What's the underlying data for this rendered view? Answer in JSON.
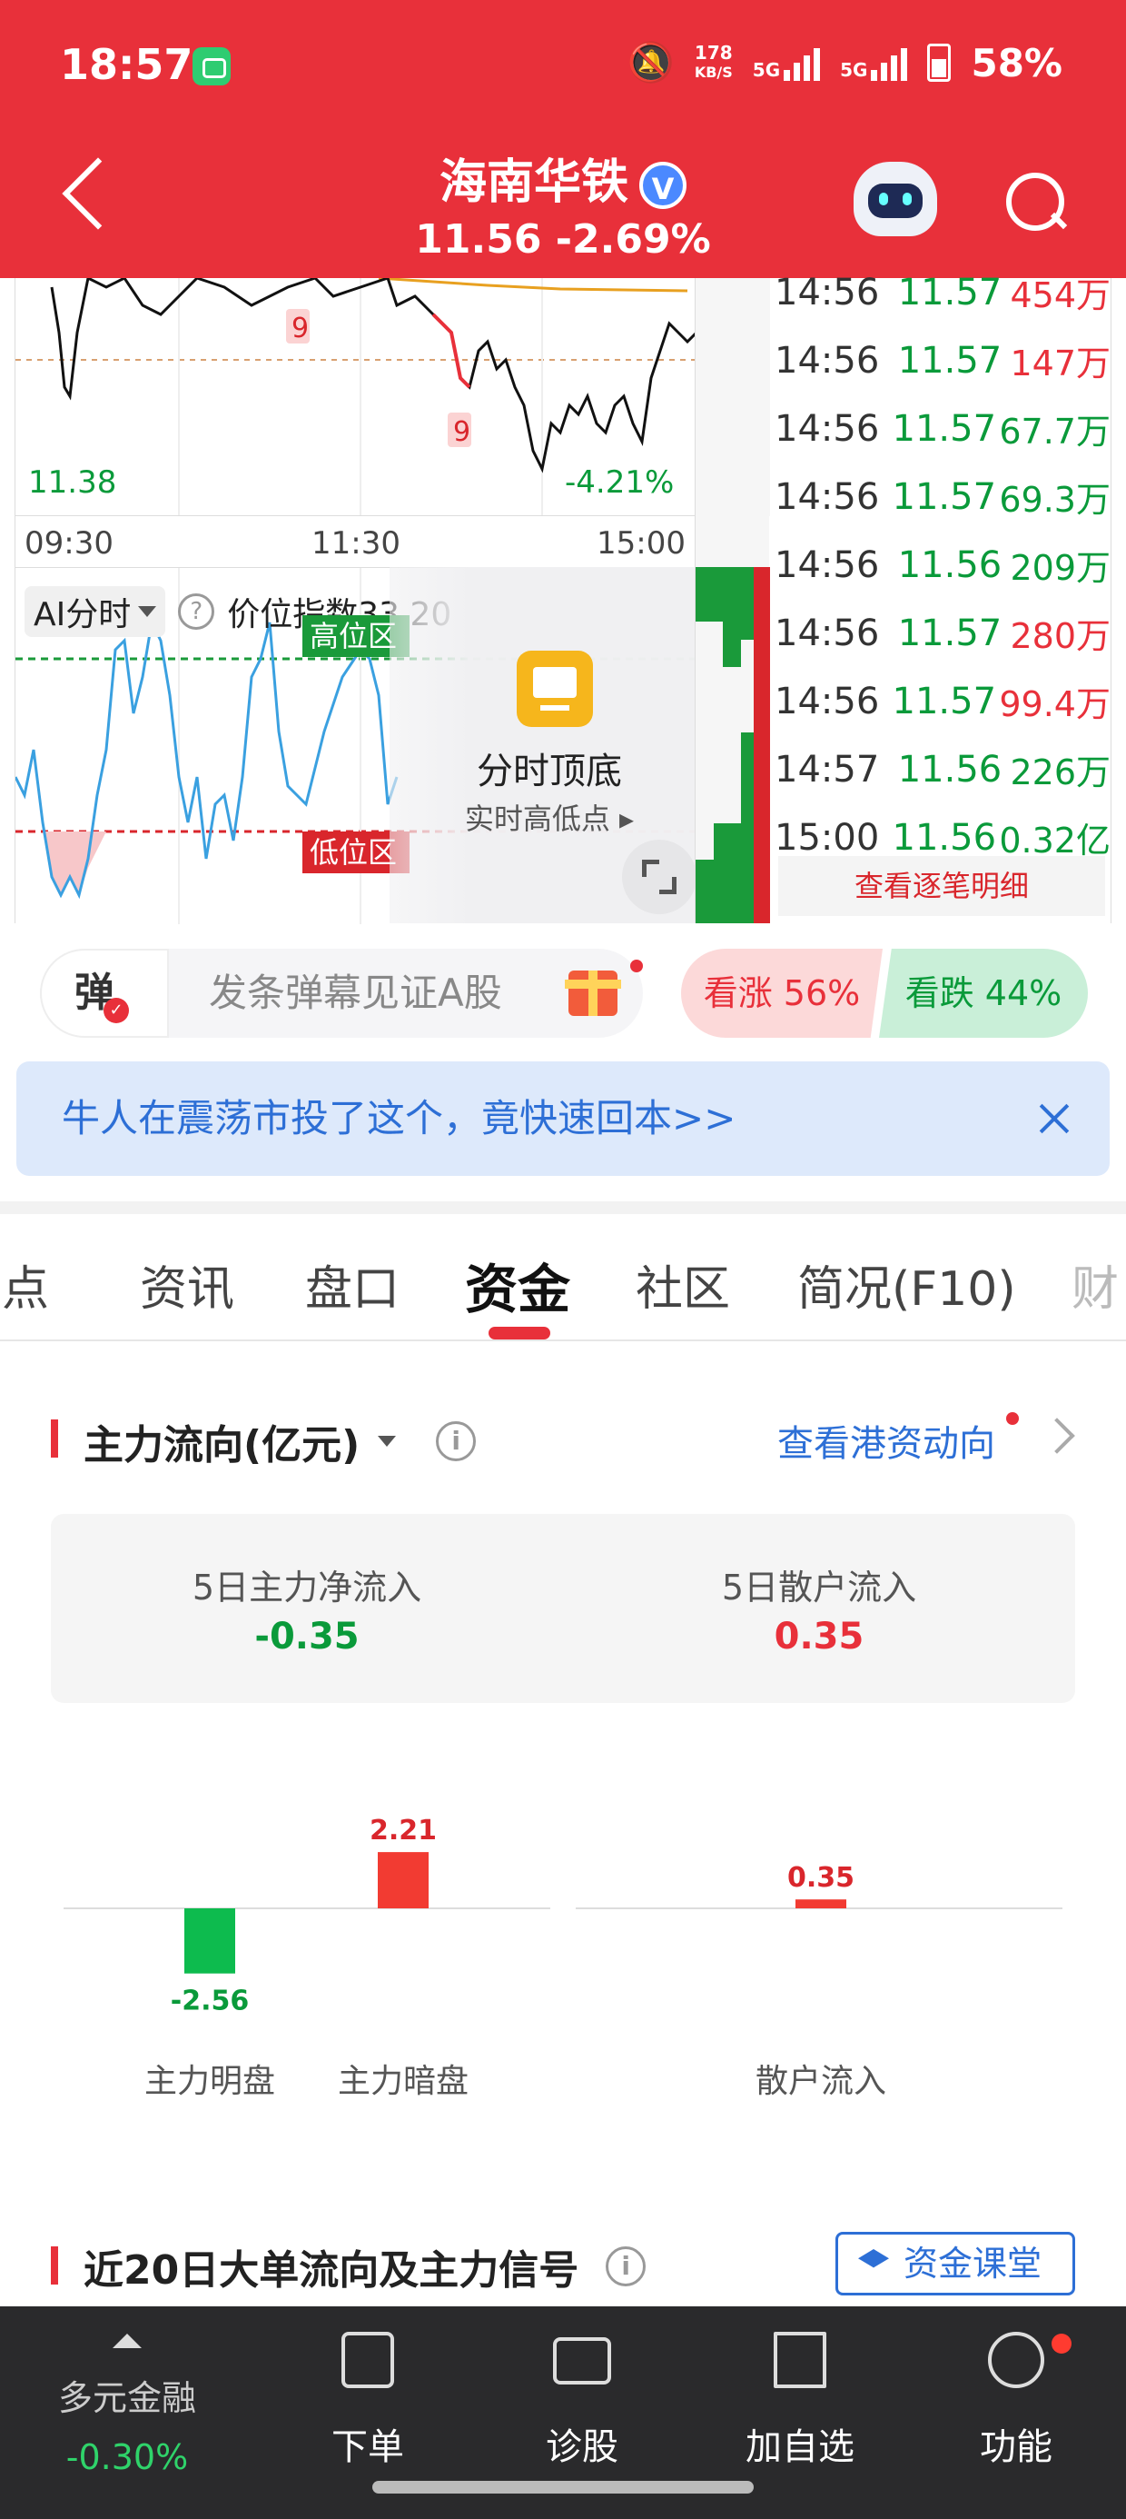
{
  "status": {
    "time": "18:57",
    "speed_value": "178",
    "speed_unit": "KB/S",
    "net1": "5G",
    "net2": "5G",
    "battery": "58%"
  },
  "header": {
    "stock_name": "海南华铁",
    "verified_mark": "V",
    "price": "11.56",
    "change": "-2.69%"
  },
  "intraday": {
    "low_price": "11.38",
    "low_pct": "-4.21%",
    "marker": "9",
    "times": [
      "09:30",
      "11:30",
      "15:00"
    ]
  },
  "ai_panel": {
    "mode_label": "AI分时",
    "help": "?",
    "index_label": "价位指数33.20",
    "high_zone": "高位区",
    "low_zone": "低位区",
    "overlay_title": "分时顶底",
    "overlay_sub": "实时高低点 ▸"
  },
  "ticks": [
    {
      "time": "14:56",
      "price": "11.57",
      "volume": "454万",
      "dir": "up"
    },
    {
      "time": "14:56",
      "price": "11.57",
      "volume": "147万",
      "dir": "up"
    },
    {
      "time": "14:56",
      "price": "11.57",
      "volume": "67.7万",
      "dir": "down"
    },
    {
      "time": "14:56",
      "price": "11.57",
      "volume": "69.3万",
      "dir": "down"
    },
    {
      "time": "14:56",
      "price": "11.56",
      "volume": "209万",
      "dir": "down"
    },
    {
      "time": "14:56",
      "price": "11.57",
      "volume": "280万",
      "dir": "up"
    },
    {
      "time": "14:56",
      "price": "11.57",
      "volume": "99.4万",
      "dir": "up"
    },
    {
      "time": "14:57",
      "price": "11.56",
      "volume": "226万",
      "dir": "down"
    },
    {
      "time": "15:00",
      "price": "11.56",
      "volume": "0.32亿",
      "dir": "down"
    }
  ],
  "detail_button": "查看逐笔明细",
  "danmu": {
    "badge": "弹",
    "placeholder": "发条弹幕见证A股"
  },
  "vote": {
    "up": "看涨 56%",
    "down": "看跌 44%",
    "up_pct": 56,
    "down_pct": 44
  },
  "banner": {
    "text": "牛人在震荡市投了这个，竟快速回本>>"
  },
  "tabs": [
    "看点",
    "资讯",
    "盘口",
    "资金",
    "社区",
    "简况(F10)",
    "财"
  ],
  "active_tab": "资金",
  "main_flow": {
    "title": "主力流向(亿元)",
    "info": "i",
    "hk_link": "查看港资动向",
    "net5_label": "5日主力净流入",
    "net5_value": "-0.35",
    "retail5_label": "5日散户流入",
    "retail5_value": "0.35"
  },
  "chart_data": {
    "type": "bar",
    "categories": [
      "主力明盘",
      "主力暗盘",
      "散户流入"
    ],
    "values": [
      -2.56,
      2.21,
      0.35
    ],
    "value_labels": [
      "-2.56",
      "2.21",
      "0.35"
    ],
    "colors": {
      "positive": "#f23b32",
      "negative": "#0dbb4e"
    }
  },
  "section2": {
    "title": "近20日大单流向及主力信号",
    "info": "i",
    "button": "资金课堂"
  },
  "bottom_bar": {
    "index_name": "多元金融",
    "index_value": "-0.30%",
    "items": [
      "下单",
      "诊股",
      "加自选",
      "功能"
    ]
  },
  "colors": {
    "brand_red": "#e8303a",
    "up_red": "#e8303a",
    "down_green": "#0a9a3a",
    "link_blue": "#2d6fd6"
  }
}
